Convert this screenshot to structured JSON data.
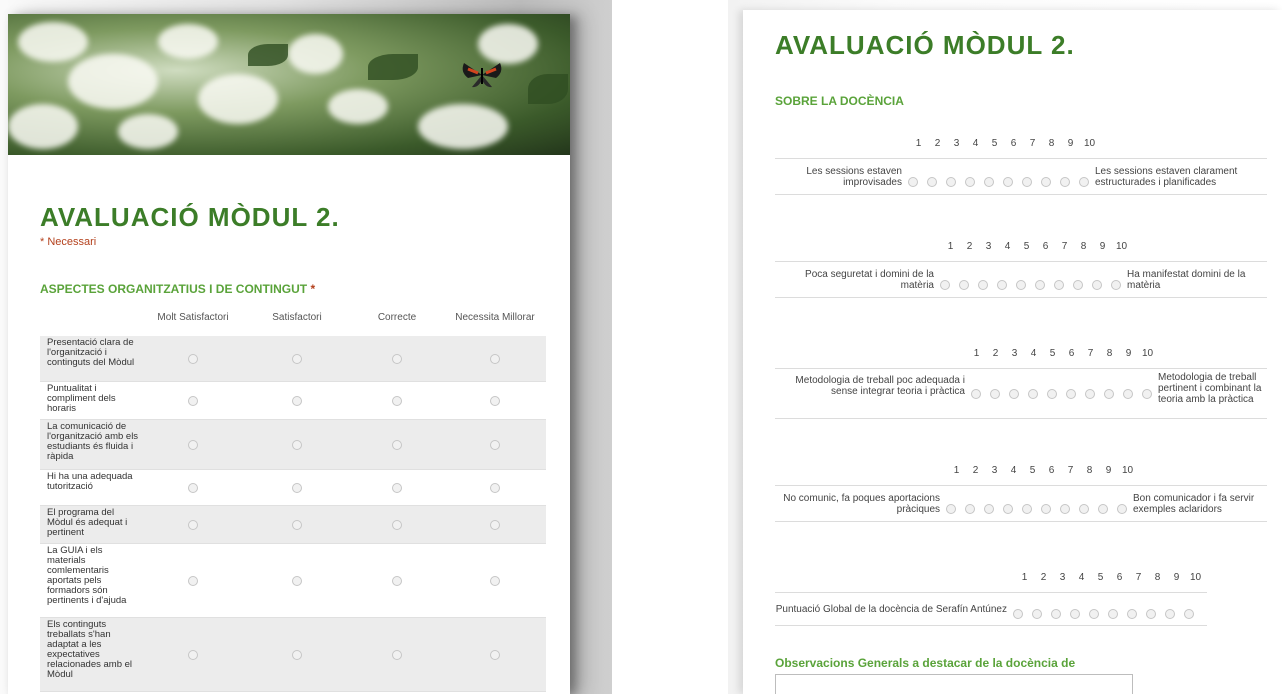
{
  "left": {
    "title": "AVALUACIÓ MÒDUL 2.",
    "required_note": "* Necessari",
    "section_title": "ASPECTES ORGANITZATIUS I DE CONTINGUT",
    "required_star": "*",
    "columns": [
      "Molt Satisfactori",
      "Satisfactori",
      "Correcte",
      "Necessita Millorar"
    ],
    "rows": [
      "Presentació clara de l'organització i continguts del Mòdul",
      "Puntualitat i compliment dels horaris",
      "La comunicació de l'organització amb els estudiants és fluida i ràpida",
      "Hi ha una adequada tutorització",
      "El programa del Mòdul és adequat i pertinent",
      "La GUIA  i els materials comlementaris aportats pels formadors són pertinents i d'ajuda",
      "Els continguts treballats s'han adaptat a les expectatives relacionades amb el Mòdul"
    ]
  },
  "right": {
    "title": "AVALUACIÓ MÒDUL 2.",
    "section_title": "SOBRE LA DOCÈNCIA",
    "scale_numbers": [
      "1",
      "2",
      "3",
      "4",
      "5",
      "6",
      "7",
      "8",
      "9",
      "10"
    ],
    "scales": [
      {
        "low": "Les sessions estaven improvisades",
        "high": "Les sessions estaven clarament estructurades i planificades"
      },
      {
        "low": "Poca seguretat i domini de la matèria",
        "high": "Ha manifestat domini de la matèria"
      },
      {
        "low": "Metodologia de treball poc adequada i sense integrar teoria i pràctica",
        "high": "Metodologia de treball pertinent i combinant la teoria amb la pràctica"
      },
      {
        "low": "No comunic, fa poques aportacions pràciques",
        "high": "Bon comunicador i fa servir exemples aclaridors"
      },
      {
        "low": "Puntuació Global de la docència de Serafín Antúnez",
        "high": ""
      }
    ],
    "observations_label": "Observacions Generals a destacar de la docència de",
    "observations_value": ""
  },
  "colors": {
    "title_green": "#3c7d28",
    "section_green": "#5aa33a",
    "required_red": "#b4411d"
  }
}
